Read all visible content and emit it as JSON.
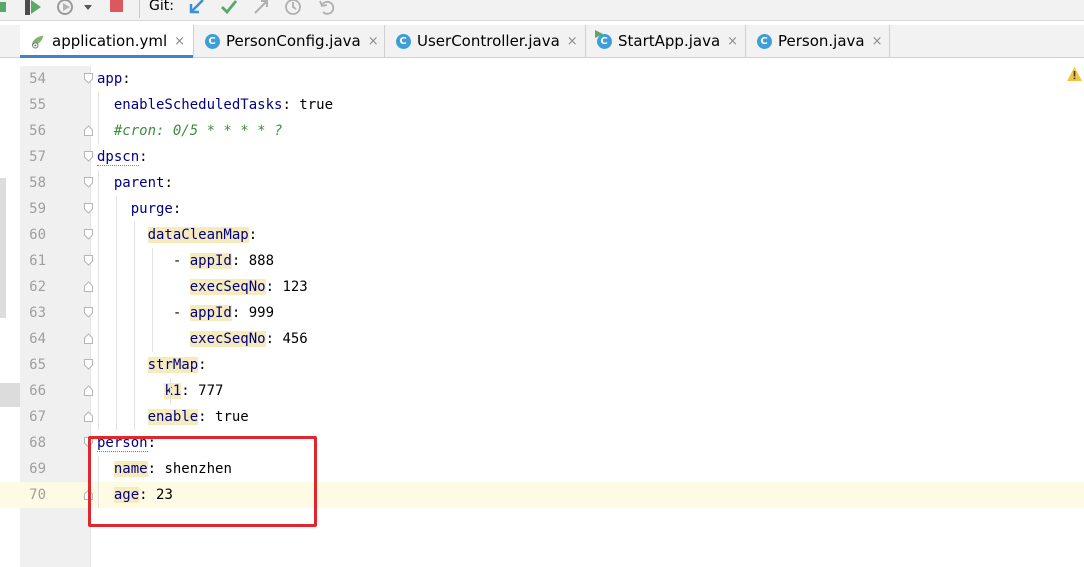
{
  "toolbar": {
    "git_label": "Git:",
    "icons": [
      "build-icon",
      "run-icon",
      "profile-icon",
      "dropdown-arrow-icon",
      "stop-icon",
      "git-update-icon",
      "git-commit-icon",
      "git-compare-icon",
      "git-history-icon",
      "git-rollback-icon"
    ]
  },
  "tabs": [
    {
      "label": "application.yml",
      "icon": "yaml-file-icon",
      "active": true,
      "close": "×"
    },
    {
      "label": "PersonConfig.java",
      "icon": "class-icon",
      "active": false,
      "close": "×"
    },
    {
      "label": "UserController.java",
      "icon": "class-icon",
      "active": false,
      "close": "×"
    },
    {
      "label": "StartApp.java",
      "icon": "run-class-icon",
      "active": false,
      "close": "×"
    },
    {
      "label": "Person.java",
      "icon": "class-icon",
      "active": false,
      "close": "×"
    }
  ],
  "class_icon_letter": "C",
  "editor": {
    "lines": [
      {
        "num": "54",
        "indent": "",
        "dash": "",
        "key": "app",
        "sep": ":",
        "value": ""
      },
      {
        "num": "55",
        "indent": "  ",
        "dash": "",
        "key": "enableScheduledTasks",
        "sep": ":",
        "value": " true"
      },
      {
        "num": "56",
        "indent": "  ",
        "dash": "",
        "key": "",
        "sep": "",
        "value": "",
        "comment": "#cron: 0/5 * * * * ?"
      },
      {
        "num": "57",
        "indent": "",
        "dash": "",
        "key": "dpscn",
        "sep": ":",
        "value": ""
      },
      {
        "num": "58",
        "indent": "  ",
        "dash": "",
        "key": "parent",
        "sep": ":",
        "value": ""
      },
      {
        "num": "59",
        "indent": "    ",
        "dash": "",
        "key": "purge",
        "sep": ":",
        "value": ""
      },
      {
        "num": "60",
        "indent": "      ",
        "dash": "",
        "key": "dataCleanMap",
        "sep": ":",
        "value": ""
      },
      {
        "num": "61",
        "indent": "         ",
        "dash": "- ",
        "key": "appId",
        "sep": ":",
        "value": " 888"
      },
      {
        "num": "62",
        "indent": "           ",
        "dash": "",
        "key": "execSeqNo",
        "sep": ":",
        "value": " 123"
      },
      {
        "num": "63",
        "indent": "         ",
        "dash": "- ",
        "key": "appId",
        "sep": ":",
        "value": " 999"
      },
      {
        "num": "64",
        "indent": "           ",
        "dash": "",
        "key": "execSeqNo",
        "sep": ":",
        "value": " 456"
      },
      {
        "num": "65",
        "indent": "      ",
        "dash": "",
        "key": "strMap",
        "sep": ":",
        "value": ""
      },
      {
        "num": "66",
        "indent": "        ",
        "dash": "",
        "key": "k1",
        "sep": ":",
        "value": " 777"
      },
      {
        "num": "67",
        "indent": "      ",
        "dash": "",
        "key": "enable",
        "sep": ":",
        "value": " true"
      },
      {
        "num": "68",
        "indent": "",
        "dash": "",
        "key": "person",
        "sep": ":",
        "value": ""
      },
      {
        "num": "69",
        "indent": "  ",
        "dash": "",
        "key": "name",
        "sep": ":",
        "value": " shenzhen"
      },
      {
        "num": "70",
        "indent": "  ",
        "dash": "",
        "key": "age",
        "sep": ":",
        "value": " 23"
      }
    ],
    "current_line": "70",
    "warning_icon": "warning-icon"
  },
  "colors": {
    "key": "#000080",
    "comment": "#3f8c3f",
    "highlight": "#f6ebbc",
    "annotation_box": "#e0262e",
    "active_tab_underline": "#4083c9"
  }
}
